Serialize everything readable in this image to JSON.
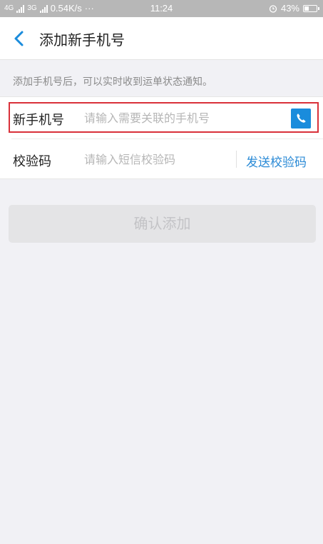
{
  "status_bar": {
    "network": "4G",
    "network2": "3G",
    "speed": "0.54K/s",
    "more": "···",
    "time": "11:24",
    "battery": "43%",
    "battery_level": 0.43
  },
  "nav": {
    "title": "添加新手机号"
  },
  "hint": "添加手机号后，可以实时收到运单状态通知。",
  "form": {
    "phone": {
      "label": "新手机号",
      "placeholder": "请输入需要关联的手机号",
      "value": ""
    },
    "code": {
      "label": "校验码",
      "placeholder": "请输入短信校验码",
      "value": "",
      "send_label": "发送校验码"
    }
  },
  "confirm_label": "确认添加",
  "colors": {
    "accent": "#1a8cdc",
    "link": "#2a8ad6",
    "highlight": "#d9313a",
    "disabled_button_bg": "#e4e4e6",
    "disabled_button_text": "#c3c3c6"
  }
}
